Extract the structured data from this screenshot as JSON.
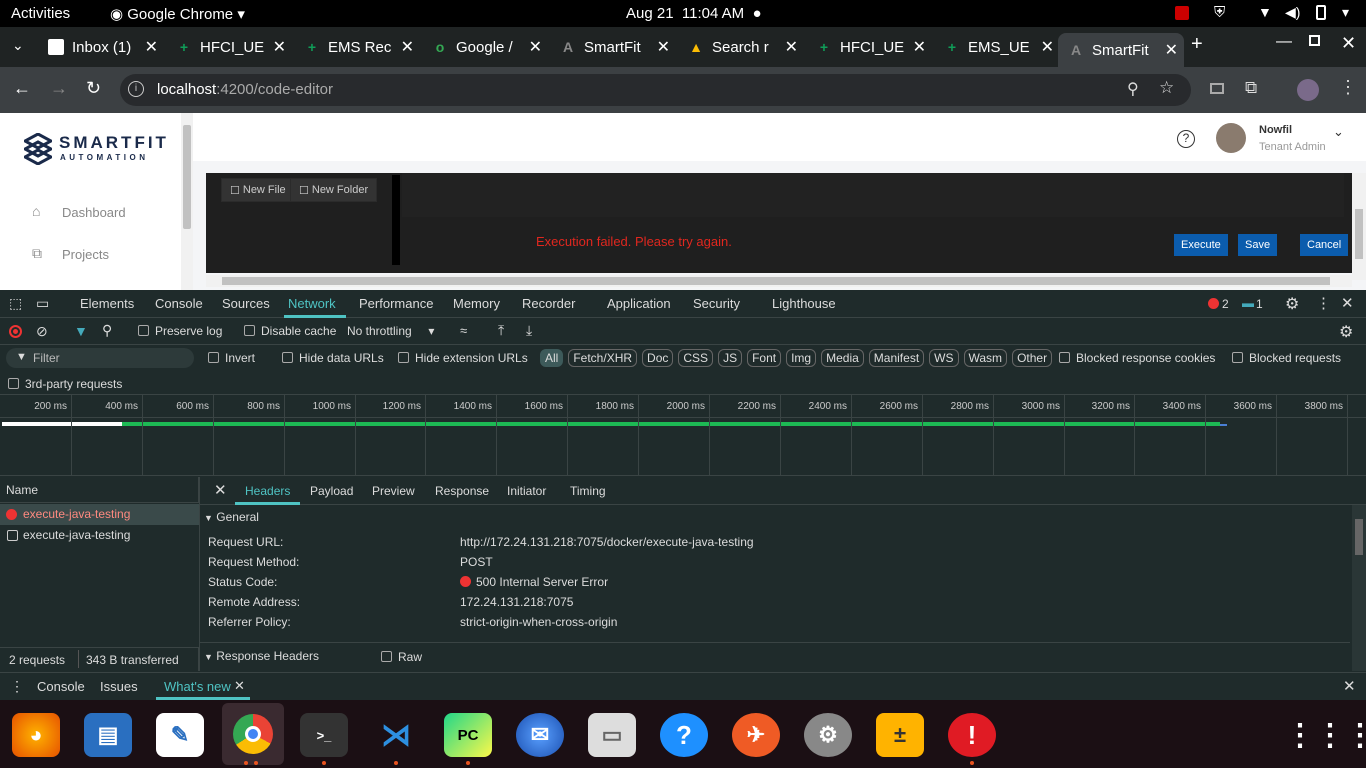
{
  "system": {
    "activities": "Activities",
    "app_name": "Google Chrome",
    "date": "Aug 21",
    "time": "11:04 AM"
  },
  "tabs": [
    {
      "label": "Inbox (1)",
      "color": "#ffffff",
      "fav": "M"
    },
    {
      "label": "HFCI_UE",
      "color": "#0f9d58",
      "fav": "+"
    },
    {
      "label": "EMS Rec",
      "color": "#0f9d58",
      "fav": "+"
    },
    {
      "label": "Google /",
      "color": "#34a853",
      "fav": "o"
    },
    {
      "label": "SmartFit",
      "color": "#888888",
      "fav": "A"
    },
    {
      "label": "Search r",
      "color": "#fbbc04",
      "fav": "▲"
    },
    {
      "label": "HFCI_UE",
      "color": "#0f9d58",
      "fav": "+"
    },
    {
      "label": "EMS_UE",
      "color": "#0f9d58",
      "fav": "+"
    },
    {
      "label": "SmartFit",
      "color": "#888888",
      "fav": "A"
    }
  ],
  "omnibox": {
    "host": "localhost",
    "path": ":4200/code-editor"
  },
  "app": {
    "logo_main": "SMARTFIT",
    "logo_sub": "AUTOMATION",
    "nav": [
      {
        "label": "Dashboard"
      },
      {
        "label": "Projects"
      }
    ],
    "user_name": "Nowfil",
    "user_role": "Tenant Admin",
    "new_file": "New File",
    "new_folder": "New Folder",
    "error": "Execution failed. Please try again.",
    "execute": "Execute",
    "save": "Save",
    "cancel": "Cancel"
  },
  "devtools": {
    "tabs": [
      "Elements",
      "Console",
      "Sources",
      "Network",
      "Performance",
      "Memory",
      "Recorder",
      "Application",
      "Security",
      "Lighthouse"
    ],
    "errors": "2",
    "messages": "1",
    "preserve_log": "Preserve log",
    "disable_cache": "Disable cache",
    "throttling": "No throttling",
    "filter": "Filter",
    "invert": "Invert",
    "hide_data": "Hide data URLs",
    "hide_ext": "Hide extension URLs",
    "types": [
      "All",
      "Fetch/XHR",
      "Doc",
      "CSS",
      "JS",
      "Font",
      "Img",
      "Media",
      "Manifest",
      "WS",
      "Wasm",
      "Other"
    ],
    "blocked_cookies": "Blocked response cookies",
    "blocked_requests": "Blocked requests",
    "third_party": "3rd-party requests",
    "ticks": [
      "200 ms",
      "400 ms",
      "600 ms",
      "800 ms",
      "1000 ms",
      "1200 ms",
      "1400 ms",
      "1600 ms",
      "1800 ms",
      "2000 ms",
      "2200 ms",
      "2400 ms",
      "2600 ms",
      "2800 ms",
      "3000 ms",
      "3200 ms",
      "3400 ms",
      "3600 ms",
      "3800 ms"
    ],
    "name_header": "Name",
    "requests": [
      {
        "name": "execute-java-testing",
        "error": true
      },
      {
        "name": "execute-java-testing",
        "error": false
      }
    ],
    "detail_tabs": [
      "Headers",
      "Payload",
      "Preview",
      "Response",
      "Initiator",
      "Timing"
    ],
    "general": "General",
    "headers": [
      {
        "k": "Request URL:",
        "v": "http://172.24.131.218:7075/docker/execute-java-testing"
      },
      {
        "k": "Request Method:",
        "v": "POST"
      },
      {
        "k": "Status Code:",
        "v": "500 Internal Server Error"
      },
      {
        "k": "Remote Address:",
        "v": "172.24.131.218:7075"
      },
      {
        "k": "Referrer Policy:",
        "v": "strict-origin-when-cross-origin"
      }
    ],
    "response_headers": "Response Headers",
    "raw": "Raw",
    "summary_requests": "2 requests",
    "summary_transferred": "343 B transferred",
    "drawer": [
      "Console",
      "Issues",
      "What's new"
    ]
  }
}
